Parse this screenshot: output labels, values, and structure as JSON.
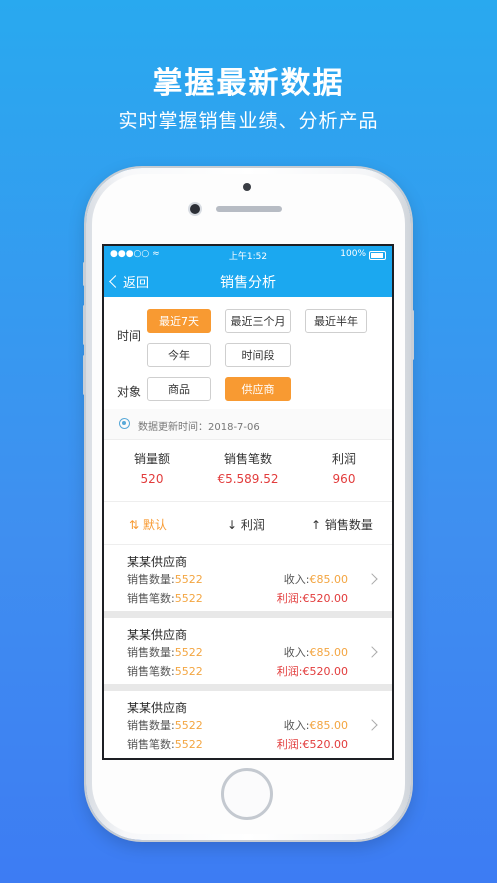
{
  "hero": {
    "title": "掌握最新数据",
    "subtitle": "实时掌握销售业绩、分析产品"
  },
  "status_bar": {
    "signal": "●●●○○",
    "wifi": "wifi-icon",
    "time": "上午1:52",
    "battery_text": "100%"
  },
  "nav": {
    "back_label": "返回",
    "title": "销售分析"
  },
  "filters": {
    "time_label": "时间",
    "time_options": [
      "最近7天",
      "最近三个月",
      "最近半年",
      "今年",
      "时间段"
    ],
    "time_selected": "最近7天",
    "object_label": "对象",
    "object_options": [
      "商品",
      "供应商"
    ],
    "object_selected": "供应商"
  },
  "update": {
    "text": "数据更新时间：2018-7-06"
  },
  "stats": [
    {
      "label": "销量额",
      "value": "520"
    },
    {
      "label": "销售笔数",
      "value": "€5.589.52"
    },
    {
      "label": "利润",
      "value": "960"
    }
  ],
  "sort": {
    "default": "⇅ 默认",
    "profit": "↓ 利润",
    "qty": "↑ 销售数量"
  },
  "suppliers": [
    {
      "name": "某某供应商",
      "qty_label": "销售数量:",
      "qty": "5522",
      "count_label": "销售笔数:",
      "count": "5522",
      "income_label": "收入:",
      "income": "€85.00",
      "profit": "利润:€520.00"
    },
    {
      "name": "某某供应商",
      "qty_label": "销售数量:",
      "qty": "5522",
      "count_label": "销售笔数:",
      "count": "5522",
      "income_label": "收入:",
      "income": "€85.00",
      "profit": "利润:€520.00"
    },
    {
      "name": "某某供应商",
      "qty_label": "销售数量:",
      "qty": "5522",
      "count_label": "销售笔数:",
      "count": "5522",
      "income_label": "收入:",
      "income": "€85.00",
      "profit": "利润:€520.00"
    }
  ],
  "colors": {
    "accent": "#1ba8f0",
    "highlight": "#f89a32",
    "red": "#e23c3c"
  }
}
